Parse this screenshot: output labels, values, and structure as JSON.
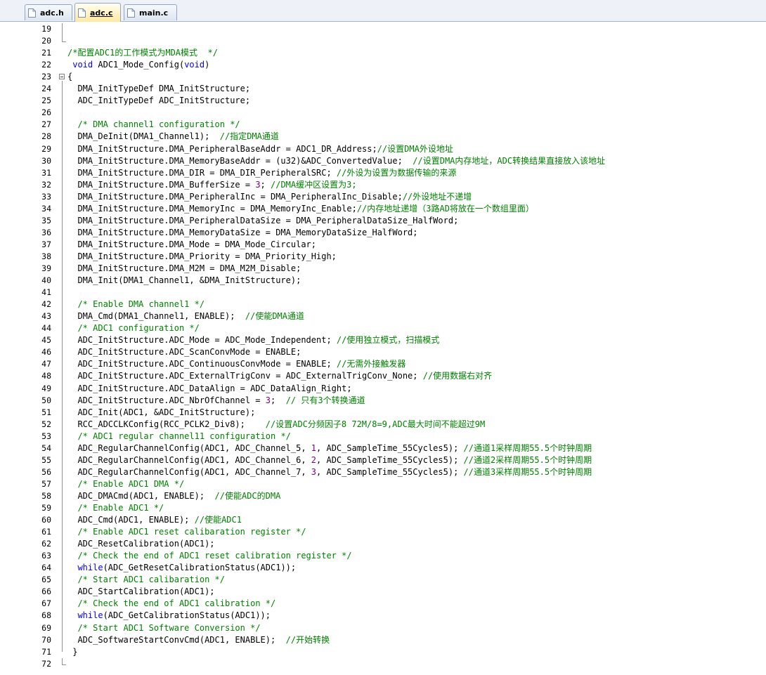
{
  "tabs": [
    {
      "label": "adc.h",
      "active": false
    },
    {
      "label": "adc.c",
      "active": true
    },
    {
      "label": "main.c",
      "active": false
    }
  ],
  "colors": {
    "comment": "#008000",
    "keyword": "#0000ff",
    "number": "#800080",
    "text": "#000000"
  },
  "editor": {
    "lines": [
      {
        "n": "19",
        "segs": []
      },
      {
        "n": "20",
        "segs": []
      },
      {
        "n": "21",
        "segs": [
          {
            "t": "/*配置ADC1的工作模式为MDA模式  */",
            "c": "comment"
          }
        ]
      },
      {
        "n": "22",
        "segs": [
          {
            "t": " ",
            "c": "plain"
          },
          {
            "t": "void",
            "c": "kw"
          },
          {
            "t": " ADC1_Mode_Config(",
            "c": "plain"
          },
          {
            "t": "void",
            "c": "kw"
          },
          {
            "t": ")",
            "c": "plain"
          }
        ]
      },
      {
        "n": "23",
        "segs": [
          {
            "t": "{",
            "c": "plain"
          }
        ]
      },
      {
        "n": "24",
        "segs": [
          {
            "t": "  DMA_InitTypeDef DMA_InitStructure;",
            "c": "plain"
          }
        ]
      },
      {
        "n": "25",
        "segs": [
          {
            "t": "  ADC_InitTypeDef ADC_InitStructure;",
            "c": "plain"
          }
        ]
      },
      {
        "n": "26",
        "segs": []
      },
      {
        "n": "27",
        "segs": [
          {
            "t": "  ",
            "c": "plain"
          },
          {
            "t": "/* DMA channel1 configuration */",
            "c": "comment"
          }
        ]
      },
      {
        "n": "28",
        "segs": [
          {
            "t": "  DMA_DeInit(DMA1_Channel1);  ",
            "c": "plain"
          },
          {
            "t": "//指定DMA通道",
            "c": "comment"
          }
        ]
      },
      {
        "n": "29",
        "segs": [
          {
            "t": "  DMA_InitStructure.DMA_PeripheralBaseAddr = ADC1_DR_Address;",
            "c": "plain"
          },
          {
            "t": "//设置DMA外设地址",
            "c": "comment"
          }
        ]
      },
      {
        "n": "30",
        "segs": [
          {
            "t": "  DMA_InitStructure.DMA_MemoryBaseAddr = (u32)&ADC_ConvertedValue;  ",
            "c": "plain"
          },
          {
            "t": "//设置DMA内存地址，ADC转换结果直接放入该地址",
            "c": "comment"
          }
        ]
      },
      {
        "n": "31",
        "segs": [
          {
            "t": "  DMA_InitStructure.DMA_DIR = DMA_DIR_PeripheralSRC; ",
            "c": "plain"
          },
          {
            "t": "//外设为设置为数据传输的来源",
            "c": "comment"
          }
        ]
      },
      {
        "n": "32",
        "segs": [
          {
            "t": "  DMA_InitStructure.DMA_BufferSize = ",
            "c": "plain"
          },
          {
            "t": "3",
            "c": "num"
          },
          {
            "t": "; ",
            "c": "plain"
          },
          {
            "t": "//DMA缓冲区设置为3;",
            "c": "comment"
          }
        ]
      },
      {
        "n": "33",
        "segs": [
          {
            "t": "  DMA_InitStructure.DMA_PeripheralInc = DMA_PeripheralInc_Disable;",
            "c": "plain"
          },
          {
            "t": "//外设地址不递增",
            "c": "comment"
          }
        ]
      },
      {
        "n": "34",
        "segs": [
          {
            "t": "  DMA_InitStructure.DMA_MemoryInc = DMA_MemoryInc_Enable;",
            "c": "plain"
          },
          {
            "t": "//内存地址递增（3路AD将放在一个数组里面）",
            "c": "comment"
          }
        ]
      },
      {
        "n": "35",
        "segs": [
          {
            "t": "  DMA_InitStructure.DMA_PeripheralDataSize = DMA_PeripheralDataSize_HalfWord;",
            "c": "plain"
          }
        ]
      },
      {
        "n": "36",
        "segs": [
          {
            "t": "  DMA_InitStructure.DMA_MemoryDataSize = DMA_MemoryDataSize_HalfWord;",
            "c": "plain"
          }
        ]
      },
      {
        "n": "37",
        "segs": [
          {
            "t": "  DMA_InitStructure.DMA_Mode = DMA_Mode_Circular;",
            "c": "plain"
          }
        ]
      },
      {
        "n": "38",
        "segs": [
          {
            "t": "  DMA_InitStructure.DMA_Priority = DMA_Priority_High;",
            "c": "plain"
          }
        ]
      },
      {
        "n": "39",
        "segs": [
          {
            "t": "  DMA_InitStructure.DMA_M2M = DMA_M2M_Disable;",
            "c": "plain"
          }
        ]
      },
      {
        "n": "40",
        "segs": [
          {
            "t": "  DMA_Init(DMA1_Channel1, &DMA_InitStructure);",
            "c": "plain"
          }
        ]
      },
      {
        "n": "41",
        "segs": []
      },
      {
        "n": "42",
        "segs": [
          {
            "t": "  ",
            "c": "plain"
          },
          {
            "t": "/* Enable DMA channel1 */",
            "c": "comment"
          }
        ]
      },
      {
        "n": "43",
        "segs": [
          {
            "t": "  DMA_Cmd(DMA1_Channel1, ENABLE);  ",
            "c": "plain"
          },
          {
            "t": "//使能DMA通道",
            "c": "comment"
          }
        ]
      },
      {
        "n": "44",
        "segs": [
          {
            "t": "  ",
            "c": "plain"
          },
          {
            "t": "/* ADC1 configuration */",
            "c": "comment"
          }
        ]
      },
      {
        "n": "45",
        "segs": [
          {
            "t": "  ADC_InitStructure.ADC_Mode = ADC_Mode_Independent; ",
            "c": "plain"
          },
          {
            "t": "//使用独立模式，扫描模式",
            "c": "comment"
          }
        ]
      },
      {
        "n": "46",
        "segs": [
          {
            "t": "  ADC_InitStructure.ADC_ScanConvMode = ENABLE;",
            "c": "plain"
          }
        ]
      },
      {
        "n": "47",
        "segs": [
          {
            "t": "  ADC_InitStructure.ADC_ContinuousConvMode = ENABLE; ",
            "c": "plain"
          },
          {
            "t": "//无需外接触发器",
            "c": "comment"
          }
        ]
      },
      {
        "n": "48",
        "segs": [
          {
            "t": "  ADC_InitStructure.ADC_ExternalTrigConv = ADC_ExternalTrigConv_None; ",
            "c": "plain"
          },
          {
            "t": "//使用数据右对齐",
            "c": "comment"
          }
        ]
      },
      {
        "n": "49",
        "segs": [
          {
            "t": "  ADC_InitStructure.ADC_DataAlign = ADC_DataAlign_Right;",
            "c": "plain"
          }
        ]
      },
      {
        "n": "50",
        "segs": [
          {
            "t": "  ADC_InitStructure.ADC_NbrOfChannel = ",
            "c": "plain"
          },
          {
            "t": "3",
            "c": "num"
          },
          {
            "t": ";  ",
            "c": "plain"
          },
          {
            "t": "// 只有3个转换通道",
            "c": "comment"
          }
        ]
      },
      {
        "n": "51",
        "segs": [
          {
            "t": "  ADC_Init(ADC1, &ADC_InitStructure);",
            "c": "plain"
          }
        ]
      },
      {
        "n": "52",
        "segs": [
          {
            "t": "  RCC_ADCCLKConfig(RCC_PCLK2_Div8);    ",
            "c": "plain"
          },
          {
            "t": "//设置ADC分频因子8 72M/8=9,ADC最大时间不能超过9M",
            "c": "comment"
          }
        ]
      },
      {
        "n": "53",
        "segs": [
          {
            "t": "  ",
            "c": "plain"
          },
          {
            "t": "/* ADC1 regular channel11 configuration */",
            "c": "comment"
          }
        ]
      },
      {
        "n": "54",
        "segs": [
          {
            "t": "  ADC_RegularChannelConfig(ADC1, ADC_Channel_5, ",
            "c": "plain"
          },
          {
            "t": "1",
            "c": "num"
          },
          {
            "t": ", ADC_SampleTime_55Cycles5); ",
            "c": "plain"
          },
          {
            "t": "//通道1采样周期55.5个时钟周期",
            "c": "comment"
          }
        ]
      },
      {
        "n": "55",
        "segs": [
          {
            "t": "  ADC_RegularChannelConfig(ADC1, ADC_Channel_6, ",
            "c": "plain"
          },
          {
            "t": "2",
            "c": "num"
          },
          {
            "t": ", ADC_SampleTime_55Cycles5); ",
            "c": "plain"
          },
          {
            "t": "//通道2采样周期55.5个时钟周期",
            "c": "comment"
          }
        ]
      },
      {
        "n": "56",
        "segs": [
          {
            "t": "  ADC_RegularChannelConfig(ADC1, ADC_Channel_7, ",
            "c": "plain"
          },
          {
            "t": "3",
            "c": "num"
          },
          {
            "t": ", ADC_SampleTime_55Cycles5); ",
            "c": "plain"
          },
          {
            "t": "//通道3采样周期55.5个时钟周期",
            "c": "comment"
          }
        ]
      },
      {
        "n": "57",
        "segs": [
          {
            "t": "  ",
            "c": "plain"
          },
          {
            "t": "/* Enable ADC1 DMA */",
            "c": "comment"
          }
        ]
      },
      {
        "n": "58",
        "segs": [
          {
            "t": "  ADC_DMACmd(ADC1, ENABLE);  ",
            "c": "plain"
          },
          {
            "t": "//使能ADC的DMA",
            "c": "comment"
          }
        ]
      },
      {
        "n": "59",
        "segs": [
          {
            "t": "  ",
            "c": "plain"
          },
          {
            "t": "/* Enable ADC1 */",
            "c": "comment"
          }
        ]
      },
      {
        "n": "60",
        "segs": [
          {
            "t": "  ADC_Cmd(ADC1, ENABLE); ",
            "c": "plain"
          },
          {
            "t": "//使能ADC1",
            "c": "comment"
          }
        ]
      },
      {
        "n": "61",
        "segs": [
          {
            "t": "  ",
            "c": "plain"
          },
          {
            "t": "/* Enable ADC1 reset calibaration register */",
            "c": "comment"
          }
        ]
      },
      {
        "n": "62",
        "segs": [
          {
            "t": "  ADC_ResetCalibration(ADC1);",
            "c": "plain"
          }
        ]
      },
      {
        "n": "63",
        "segs": [
          {
            "t": "  ",
            "c": "plain"
          },
          {
            "t": "/* Check the end of ADC1 reset calibration register */",
            "c": "comment"
          }
        ]
      },
      {
        "n": "64",
        "segs": [
          {
            "t": "  ",
            "c": "plain"
          },
          {
            "t": "while",
            "c": "kw"
          },
          {
            "t": "(ADC_GetResetCalibrationStatus(ADC1));",
            "c": "plain"
          }
        ]
      },
      {
        "n": "65",
        "segs": [
          {
            "t": "  ",
            "c": "plain"
          },
          {
            "t": "/* Start ADC1 calibaration */",
            "c": "comment"
          }
        ]
      },
      {
        "n": "66",
        "segs": [
          {
            "t": "  ADC_StartCalibration(ADC1);",
            "c": "plain"
          }
        ]
      },
      {
        "n": "67",
        "segs": [
          {
            "t": "  ",
            "c": "plain"
          },
          {
            "t": "/* Check the end of ADC1 calibration */",
            "c": "comment"
          }
        ]
      },
      {
        "n": "68",
        "segs": [
          {
            "t": "  ",
            "c": "plain"
          },
          {
            "t": "while",
            "c": "kw"
          },
          {
            "t": "(ADC_GetCalibrationStatus(ADC1));",
            "c": "plain"
          }
        ]
      },
      {
        "n": "69",
        "segs": [
          {
            "t": "  ",
            "c": "plain"
          },
          {
            "t": "/* Start ADC1 Software Conversion */",
            "c": "comment"
          }
        ]
      },
      {
        "n": "70",
        "segs": [
          {
            "t": "  ADC_SoftwareStartConvCmd(ADC1, ENABLE);  ",
            "c": "plain"
          },
          {
            "t": "//开始转换",
            "c": "comment"
          }
        ]
      },
      {
        "n": "71",
        "segs": [
          {
            "t": " }",
            "c": "plain"
          }
        ]
      },
      {
        "n": "72",
        "segs": []
      }
    ]
  }
}
